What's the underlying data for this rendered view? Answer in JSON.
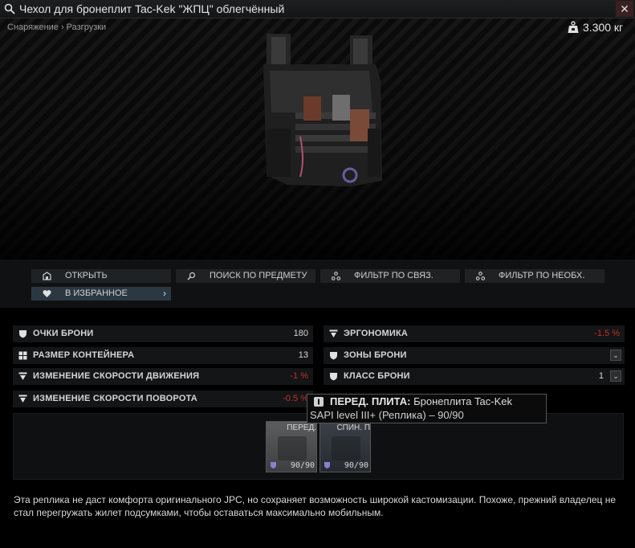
{
  "window": {
    "title": "Чехол для бронеплит Tac-Kek \"ЖПЦ\" облегчённый",
    "close_label": "✕",
    "breadcrumb": "Снаряжение › Разгрузки",
    "weight": "3.300 кг"
  },
  "actions": {
    "open": "ОТКРЫТЬ",
    "search_item": "ПОИСК ПО ПРЕДМЕТУ",
    "filter_linked": "ФИЛЬТР ПО СВЯЗ.",
    "filter_needed": "ФИЛЬТР ПО НЕОБХ.",
    "favorite": "В ИЗБРАННОЕ",
    "favorite_arrow": "›"
  },
  "stats": {
    "armor_points": {
      "label": "ОЧКИ БРОНИ",
      "value": "180"
    },
    "container_size": {
      "label": "РАЗМЕР КОНТЕЙНЕРА",
      "value": "13"
    },
    "move_speed": {
      "label": "ИЗМЕНЕНИЕ СКОРОСТИ ДВИЖЕНИЯ",
      "value": "-1 %"
    },
    "turn_speed": {
      "label": "ИЗМЕНЕНИЕ СКОРОСТИ ПОВОРОТА",
      "value": "-0.5 %"
    },
    "ergonomics": {
      "label": "ЭРГОНОМИКА",
      "value": "-1.5 %"
    },
    "armor_zones": {
      "label": "ЗОНЫ БРОНИ",
      "value": ""
    },
    "armor_class": {
      "label": "КЛАСС БРОНИ",
      "value": "1"
    },
    "dropdown_glyph": "⌄"
  },
  "slots": [
    {
      "label": "ПЕРЕД.",
      "value": "90/90"
    },
    {
      "label": "СПИН. П",
      "value": "90/90"
    }
  ],
  "tooltip": {
    "title": "ПЕРЕД. ПЛИТА:",
    "text1": "Бронеплита Tac-Kek",
    "text2": "SAPI level III+ (Реплика) – 90/90"
  },
  "description": "Эта реплика не даст комфорта оригинального JPC, но сохраняет возможность широкой кастомизации. Похоже, прежний владелец не стал перегружать жилет подсумками, чтобы оставаться максимально мобильным.",
  "colors": {
    "accent_favorite": "#2b3842",
    "negative": "#c0302b"
  },
  "icons": [
    "search-icon",
    "close-icon",
    "weight-icon",
    "open-icon",
    "search-item-icon",
    "filter-linked-icon",
    "filter-needed-icon",
    "heart-icon",
    "shield-icon",
    "grid-icon",
    "speed-icon",
    "info-icon"
  ]
}
